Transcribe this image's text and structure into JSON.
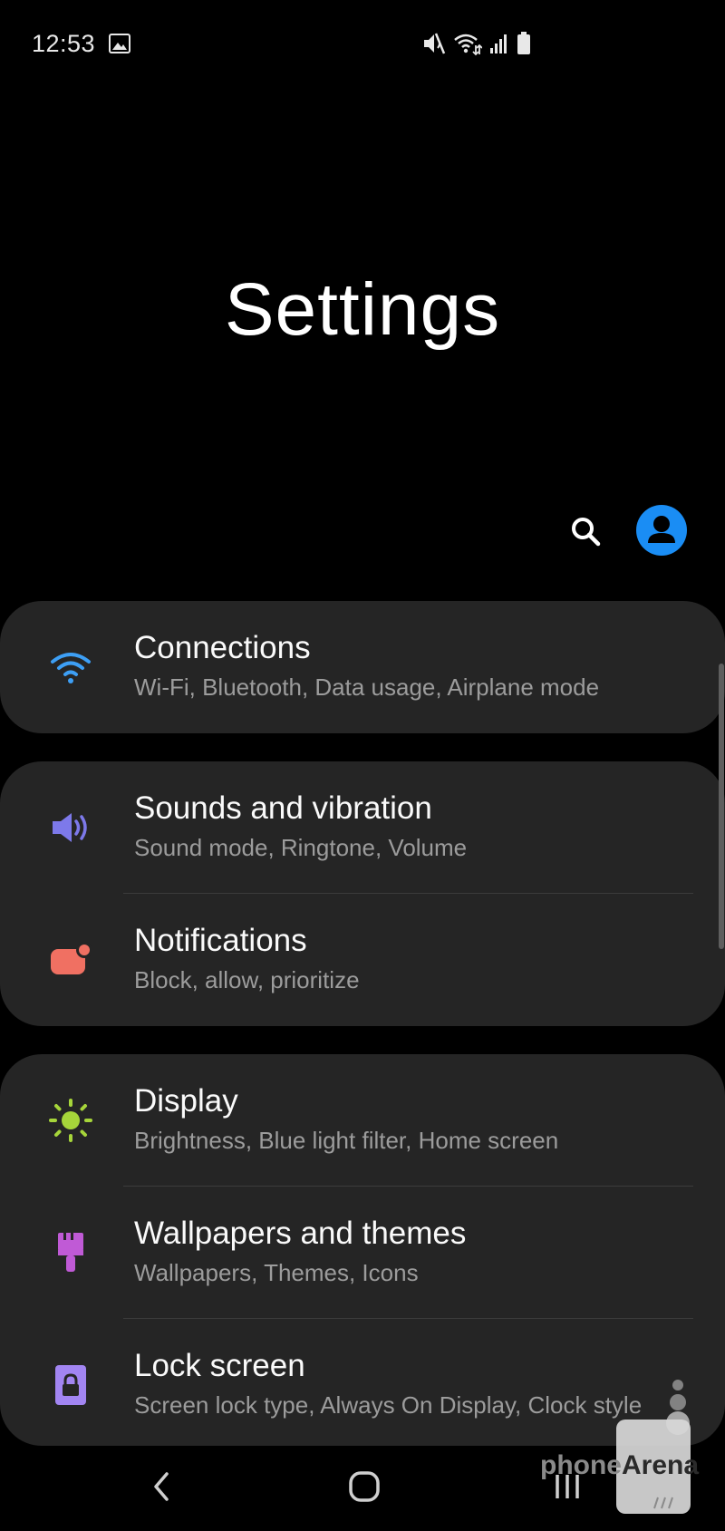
{
  "status_bar": {
    "time": "12:53",
    "icons": [
      "gallery-icon",
      "mute-icon",
      "wifi-icon",
      "signal-icon",
      "battery-icon"
    ]
  },
  "page": {
    "title": "Settings"
  },
  "header": {
    "search_icon": "search-icon",
    "profile_icon": "account-icon"
  },
  "colors": {
    "card_bg": "#252525",
    "connections_icon": "#3d9ff5",
    "sounds_icon": "#7d79ea",
    "notifications_icon": "#f07062",
    "display_icon": "#a6d53a",
    "wallpapers_icon": "#c05ad6",
    "lock_icon": "#a285f2",
    "profile": "#1a8df4"
  },
  "groups": [
    {
      "items": [
        {
          "title": "Connections",
          "subtitle": "Wi-Fi, Bluetooth, Data usage, Airplane mode",
          "icon": "wifi-icon"
        }
      ]
    },
    {
      "items": [
        {
          "title": "Sounds and vibration",
          "subtitle": "Sound mode, Ringtone, Volume",
          "icon": "speaker-icon"
        },
        {
          "title": "Notifications",
          "subtitle": "Block, allow, prioritize",
          "icon": "notification-badge-icon"
        }
      ]
    },
    {
      "items": [
        {
          "title": "Display",
          "subtitle": "Brightness, Blue light filter, Home screen",
          "icon": "brightness-icon"
        },
        {
          "title": "Wallpapers and themes",
          "subtitle": "Wallpapers, Themes, Icons",
          "icon": "paint-brush-icon"
        },
        {
          "title": "Lock screen",
          "subtitle": "Screen lock type, Always On Display, Clock style",
          "icon": "lock-icon"
        }
      ]
    }
  ],
  "nav_bar": {
    "back_icon": "back-icon",
    "home_icon": "home-icon",
    "recents_icon": "recents-icon"
  },
  "watermark": {
    "part1": "phone",
    "part2": "Arena"
  }
}
